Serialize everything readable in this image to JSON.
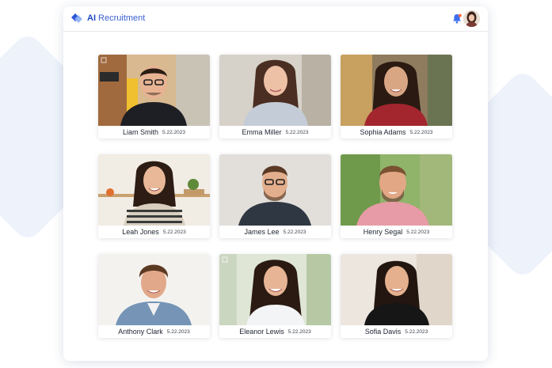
{
  "app": {
    "brand_prefix": "AI",
    "brand_rest": " Recruitment"
  },
  "candidates": [
    {
      "name": "Liam Smith",
      "date": "5.22.2023"
    },
    {
      "name": "Emma Miller",
      "date": "5.22.2023"
    },
    {
      "name": "Sophia Adams",
      "date": "5.22.2023"
    },
    {
      "name": "Leah Jones",
      "date": "5.22.2023"
    },
    {
      "name": "James Lee",
      "date": "5.22.2023"
    },
    {
      "name": "Henry Segal",
      "date": "5.22.2023"
    },
    {
      "name": "Anthony Clark",
      "date": "5.22.2023"
    },
    {
      "name": "Eleanor Lewis",
      "date": "5.22.2023"
    },
    {
      "name": "Sofia Davis",
      "date": "5.22.2023"
    }
  ],
  "icons": {
    "logo": "diamond-logo-icon",
    "notification": "bell-icon",
    "profile": "user-avatar"
  },
  "colors": {
    "brand": "#2148c4",
    "bell": "#3a6df0",
    "background_shape": "#eef3fb"
  }
}
